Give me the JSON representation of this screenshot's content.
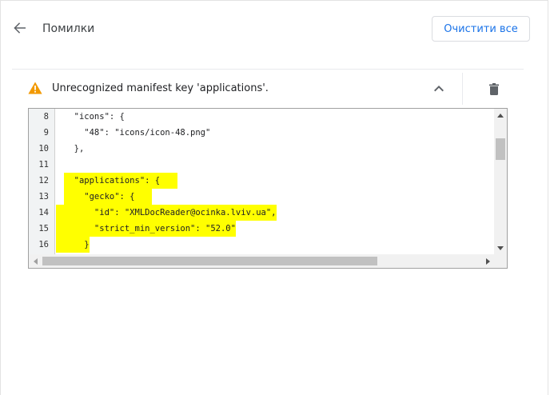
{
  "header": {
    "title": "Помилки",
    "clear_all_label": "Очистити все"
  },
  "error": {
    "message": "Unrecognized manifest key 'applications'."
  },
  "code": {
    "lines": [
      {
        "num": "8",
        "text": "  \"icons\": {",
        "highlight": false
      },
      {
        "num": "9",
        "text": "    \"48\": \"icons/icon-48.png\"",
        "highlight": false
      },
      {
        "num": "10",
        "text": "  },",
        "highlight": false
      },
      {
        "num": "11",
        "text": "",
        "highlight": false
      },
      {
        "num": "12",
        "text": "  \"applications\": {",
        "highlight": true
      },
      {
        "num": "13",
        "text": "    \"gecko\": {",
        "highlight": true
      },
      {
        "num": "14",
        "text": "      \"id\": \"XMLDocReader@ocinka.lviv.ua\",",
        "highlight": true
      },
      {
        "num": "15",
        "text": "      \"strict_min_version\": \"52.0\"",
        "highlight": true
      },
      {
        "num": "16",
        "text": "    }",
        "highlight": true
      }
    ]
  },
  "colors": {
    "accent": "#1a73e8",
    "warning": "#f29900",
    "highlight": "#ffff00"
  },
  "icons": {
    "back": "arrow-back-icon",
    "warning": "warning-icon",
    "collapse": "chevron-up-icon",
    "delete": "trash-icon"
  }
}
